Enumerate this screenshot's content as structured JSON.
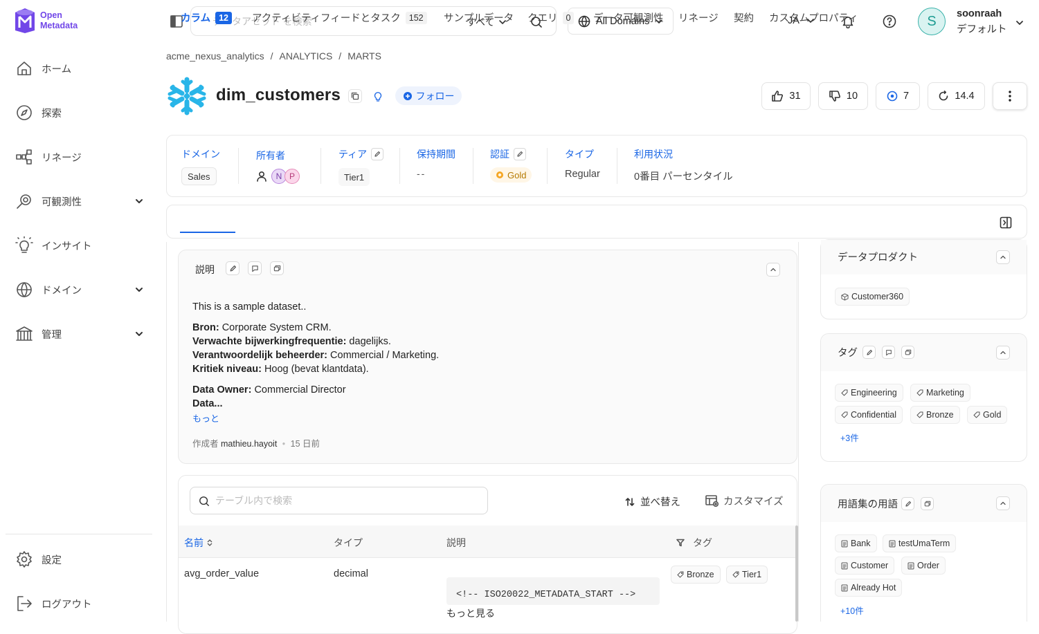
{
  "logo": {
    "line1": "Open",
    "line2": "Metadata"
  },
  "sidebar": {
    "items": [
      {
        "label": "ホーム"
      },
      {
        "label": "探索"
      },
      {
        "label": "リネージ"
      },
      {
        "label": "可観測性"
      },
      {
        "label": "インサイト"
      },
      {
        "label": "ドメイン"
      },
      {
        "label": "管理"
      }
    ],
    "bottom": [
      {
        "label": "設定"
      },
      {
        "label": "ログアウト"
      }
    ]
  },
  "header": {
    "search_placeholder": "データアセット を検索",
    "search_scope": "すべて",
    "domains": "All Domains",
    "language": "JA",
    "user": {
      "initial": "S",
      "name": "soonraah",
      "role": "デフォルト"
    }
  },
  "breadcrumb": [
    "acme_nexus_analytics",
    "ANALYTICS",
    "MARTS"
  ],
  "entity": {
    "title": "dim_customers",
    "follow_label": "フォロー",
    "stats": {
      "likes": "31",
      "dislikes": "10",
      "followers": "7",
      "version": "14.4"
    }
  },
  "info": {
    "domain": {
      "label": "ドメイン",
      "value": "Sales"
    },
    "owner": {
      "label": "所有者",
      "owners": [
        "N",
        "P"
      ]
    },
    "tier": {
      "label": "ティア",
      "value": "Tier1"
    },
    "retention": {
      "label": "保持期間",
      "value": "--"
    },
    "certification": {
      "label": "認証",
      "value": "Gold"
    },
    "type": {
      "label": "タイプ",
      "value": "Regular"
    },
    "usage": {
      "label": "利用状況",
      "value": "0番目 パーセンタイル"
    }
  },
  "tabs": [
    {
      "label": "カラム",
      "count": "12"
    },
    {
      "label": "アクティビティフィードとタスク",
      "count": "152"
    },
    {
      "label": "サンプルデータ"
    },
    {
      "label": "クエリ",
      "count": "0"
    },
    {
      "label": "データ可観測性"
    },
    {
      "label": "リネージ"
    },
    {
      "label": "契約"
    },
    {
      "label": "カスタムプロパティ"
    }
  ],
  "description": {
    "heading": "説明",
    "intro": "This is a sample dataset..",
    "lines": [
      {
        "key": "Bron:",
        "value": " Corporate System CRM."
      },
      {
        "key": "Verwachte bijwerkingfrequentie:",
        "value": " dagelijks."
      },
      {
        "key": "Verantwoordelijk beheerder:",
        "value": " Commercial / Marketing."
      },
      {
        "key": "Kritiek niveau:",
        "value": " Hoog (bevat klantdata)."
      },
      {
        "key": "Data Owner:",
        "value": " Commercial Director"
      },
      {
        "key": "Data...",
        "value": ""
      }
    ],
    "more_label": "もっと",
    "meta_prefix": "作成者",
    "author": "mathieu.hayoit",
    "age": "15 日前"
  },
  "table": {
    "search_placeholder": "テーブル内で検索",
    "sort_label": "並べ替え",
    "customize_label": "カスタマイズ",
    "headers": {
      "name": "名前",
      "type": "タイプ",
      "description": "説明",
      "tags": "タグ"
    },
    "rows": [
      {
        "name": "avg_order_value",
        "type": "decimal",
        "description": "<!-- ISO20022_METADATA_START -->",
        "more_label": "もっと見る",
        "tags": [
          "Bronze",
          "Tier1"
        ]
      }
    ]
  },
  "right": {
    "data_product": {
      "title": "データプロダクト",
      "items": [
        "Customer360"
      ]
    },
    "tags": {
      "title": "タグ",
      "items": [
        "Engineering",
        "Marketing",
        "Confidential",
        "Bronze",
        "Gold"
      ],
      "more": "+3件"
    },
    "glossary": {
      "title": "用語集の用語",
      "items": [
        "Bank",
        "testUmaTerm",
        "Customer",
        "Order",
        "Already Hot"
      ],
      "more": "+10件"
    }
  },
  "colors": {
    "accent": "#1a66e5",
    "brand": "#7147e8",
    "snowflake": "#29b5e8",
    "gold": "#f5a623"
  }
}
